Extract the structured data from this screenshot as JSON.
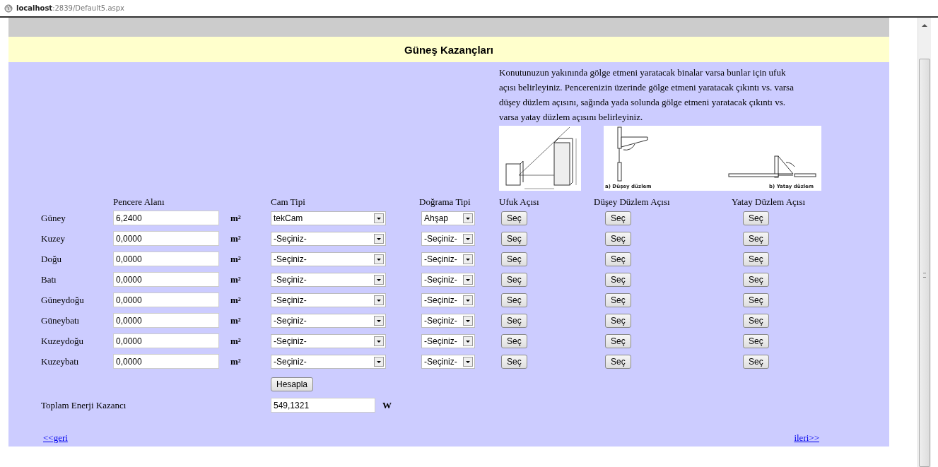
{
  "browser": {
    "address_host": "localhost",
    "address_path": ":2839/Default5.aspx"
  },
  "subtitle": "Güneş Kazançları",
  "description": "Konutunuzun yakınında gölge etmeni yaratacak binalar varsa bunlar için ufuk açısı belirleyiniz. Pencerenizin üzerinde gölge etmeni yaratacak çıkıntı vs. varsa düşey düzlem açısını, sağında yada solunda gölge etmeni yaratacak çıkıntı vs. varsa yatay düzlem açısını belirleyiniz.",
  "figure_captions": [
    "a) Düşey düzlem",
    "b) Yatay düzlem"
  ],
  "columns": [
    "Pencere Alanı",
    "Cam Tipi",
    "Doğrama Tipi",
    "Ufuk Açısı",
    "Düşey Düzlem Açısı",
    "Yatay Düzlem Açısı"
  ],
  "rows": [
    {
      "direction": "Güney",
      "area": "6,2400",
      "unit": "m²",
      "glass": "tekCam",
      "frame": "Ahşap",
      "buttons": [
        "Seç",
        "Seç",
        "Seç"
      ]
    },
    {
      "direction": "Kuzey",
      "area": "0,0000",
      "unit": "m²",
      "glass": "-Seçiniz-",
      "frame": "-Seçiniz-",
      "buttons": [
        "Seç",
        "Seç",
        "Seç"
      ]
    },
    {
      "direction": "Doğu",
      "area": "0,0000",
      "unit": "m²",
      "glass": "-Seçiniz-",
      "frame": "-Seçiniz-",
      "buttons": [
        "Seç",
        "Seç",
        "Seç"
      ]
    },
    {
      "direction": "Batı",
      "area": "0,0000",
      "unit": "m²",
      "glass": "-Seçiniz-",
      "frame": "-Seçiniz-",
      "buttons": [
        "Seç",
        "Seç",
        "Seç"
      ]
    },
    {
      "direction": "Güneydoğu",
      "area": "0,0000",
      "unit": "m²",
      "glass": "-Seçiniz-",
      "frame": "-Seçiniz-",
      "buttons": [
        "Seç",
        "Seç",
        "Seç"
      ]
    },
    {
      "direction": "Güneybatı",
      "area": "0,0000",
      "unit": "m²",
      "glass": "-Seçiniz-",
      "frame": "-Seçiniz-",
      "buttons": [
        "Seç",
        "Seç",
        "Seç"
      ]
    },
    {
      "direction": "Kuzeydoğu",
      "area": "0,0000",
      "unit": "m²",
      "glass": "-Seçiniz-",
      "frame": "-Seçiniz-",
      "buttons": [
        "Seç",
        "Seç",
        "Seç"
      ]
    },
    {
      "direction": "Kuzeybatı",
      "area": "0,0000",
      "unit": "m²",
      "glass": "-Seçiniz-",
      "frame": "-Seçiniz-",
      "buttons": [
        "Seç",
        "Seç",
        "Seç"
      ]
    }
  ],
  "calculate_button": "Hesapla",
  "total": {
    "label": "Toplam Enerji Kazancı",
    "value": "549,1321",
    "unit": "W"
  },
  "back_link": "<<geri",
  "next_link": "ileri>>"
}
